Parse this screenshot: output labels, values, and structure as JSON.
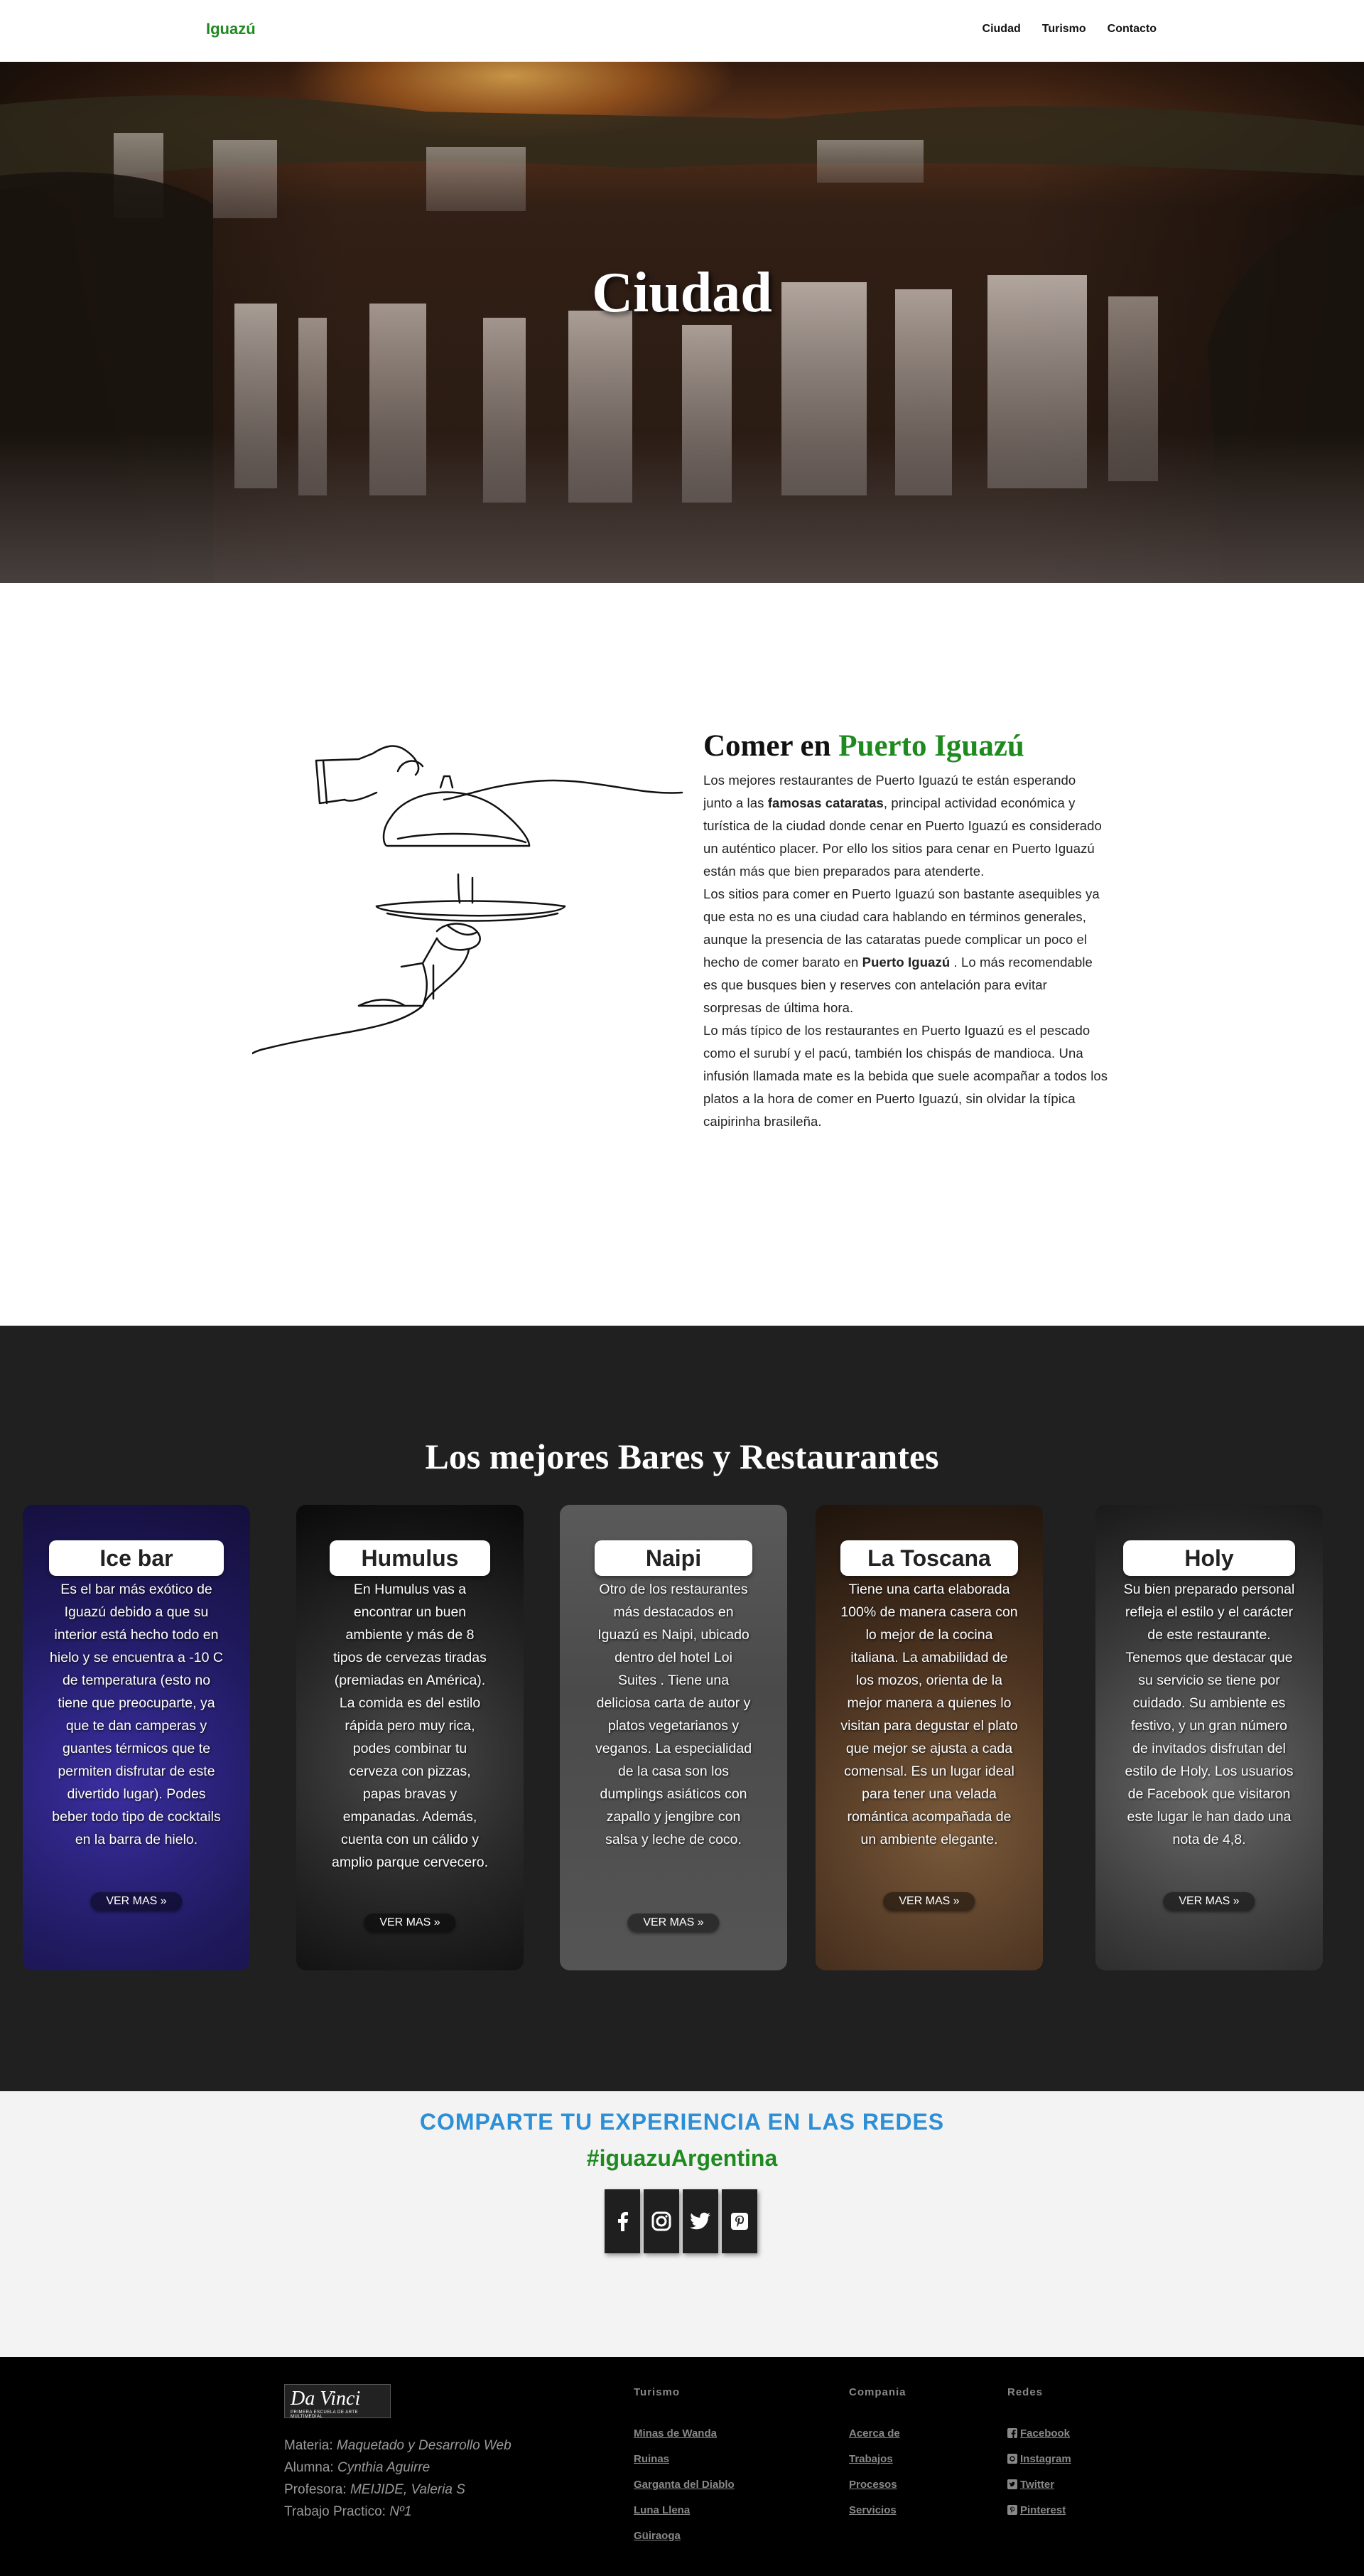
{
  "nav": {
    "brand": "Iguazú",
    "links": [
      "Ciudad",
      "Turismo",
      "Contacto"
    ]
  },
  "hero": {
    "title": "Ciudad"
  },
  "about": {
    "title_prefix": "Comer en",
    "title_highlight": "Puerto Iguazú",
    "p1_a": "Los mejores restaurantes de Puerto Iguazú te están esperando junto a las",
    "p1_b": "famosas cataratas",
    "p1_c": ", principal actividad económica y turística de la ciudad donde cenar en Puerto Iguazú es considerado un auténtico placer. Por ello los sitios para cenar en Puerto Iguazú están más que bien preparados para atenderte.",
    "p2_a": "Los sitios para comer en Puerto Iguazú son bastante asequibles ya que esta no es una ciudad cara hablando en términos generales, aunque la presencia de las cataratas puede complicar un poco el hecho de comer barato en",
    "p2_b": "Puerto Iguazú",
    "p2_c": ". Lo más recomendable es que busques bien y reserves con antelación para evitar sorpresas de última hora.",
    "p3": "Lo más típico de los restaurantes en Puerto Iguazú es el pescado como el surubí y el pacú, también los chispás de mandioca. Una infusión llamada mate es la bebida que suele acompañar a todos los platos a la hora de comer en Puerto Iguazú, sin olvidar la típica caipirinha brasileña."
  },
  "bares": {
    "title": "Los mejores Bares y Restaurantes",
    "button_label": "VER MAS »",
    "cards": [
      {
        "name": "Ice bar",
        "desc": "Es el bar más exótico de Iguazú debido a que su interior está hecho todo en hielo y se encuentra a -10 C de temperatura (esto no tiene que preocuparte, ya que te dan camperas y guantes térmicos que te permiten disfrutar de este divertido lugar). Podes beber todo tipo de cocktails en la barra de hielo.",
        "accent": "#3a2a8a"
      },
      {
        "name": "Humulus",
        "desc": "En Humulus vas a encontrar un buen ambiente y más de 8 tipos de cervezas tiradas (premiadas en América). La comida es del estilo rápida pero muy rica, podes combinar tu cerveza con pizzas, papas bravas y empanadas. Además, cuenta con un cálido y amplio parque cervecero.",
        "accent": "#3b3b3b"
      },
      {
        "name": "Naipi",
        "desc": "Otro de los restaurantes más destacados en Iguazú es Naipi, ubicado dentro del hotel Loi Suites . Tiene una deliciosa carta de autor y platos vegetarianos y veganos. La especialidad de la casa son los dumplings asiáticos con zapallo y jengibre con salsa y leche de coco.",
        "accent": "#5c5c5c"
      },
      {
        "name": "La Toscana",
        "desc": "Tiene una carta elaborada 100% de manera casera con lo mejor de la cocina italiana. La amabilidad de los mozos, orienta de la mejor manera a quienes lo visitan para degustar el plato que mejor se ajusta a cada comensal. Es un lugar ideal para tener una velada romántica acompañada de un ambiente elegante.",
        "accent": "#6a4a2a"
      },
      {
        "name": "Holy",
        "desc": "Su bien preparado personal refleja el estilo y el carácter de este restaurante. Tenemos que destacar que su servicio se tiene por cuidado. Su ambiente es festivo, y un gran número de invitados disfrutan del estilo de Holy. Los usuarios de Facebook que visitaron este lugar le han dado una nota de 4,8.",
        "accent": "#4a4a4a"
      }
    ]
  },
  "social": {
    "title": "COMPARTE TU EXPERIENCIA EN LAS REDES",
    "hashtag": "#iguazuArgentina",
    "icons": [
      "facebook-icon",
      "instagram-icon",
      "twitter-icon",
      "pinterest-icon"
    ]
  },
  "footer": {
    "logo_text": "Da Vinci",
    "logo_sub": "PRIMERA ESCUELA DE ARTE MULTIMEDIAL",
    "materia_label": "Materia:",
    "materia_value": "Maquetado y Desarrollo Web",
    "alumna_label": "Alumna:",
    "alumna_value": "Cynthia Aguirre",
    "profesora_label": "Profesora:",
    "profesora_value": "MEIJIDE, Valeria S",
    "trabajo_label": "Trabajo Practico:",
    "trabajo_value": "Nº1",
    "turismo": {
      "heading": "Turismo",
      "links": [
        "Minas de Wanda",
        "Ruinas",
        "Garganta del Diablo",
        "Luna Llena",
        "Güiraoga"
      ]
    },
    "compania": {
      "heading": "Compania",
      "links": [
        "Acerca de",
        "Trabajos",
        "Procesos",
        "Servicios"
      ]
    },
    "redes": {
      "heading": "Redes",
      "links": [
        "Facebook",
        "Instagram",
        "Twitter",
        "Pinterest"
      ]
    }
  }
}
